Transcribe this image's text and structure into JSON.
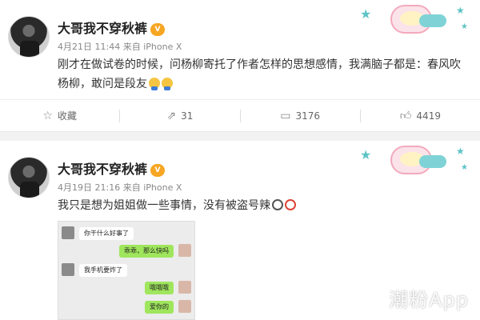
{
  "posts": [
    {
      "username": "大哥我不穿秋裤",
      "vip_badge": "V",
      "date": "4月21日 11:44",
      "source_prefix": "来自",
      "source": "iPhone X",
      "content": "刚才在做试卷的时候，问杨柳寄托了作者怎样的思想感情，我满脑子都是：春风吹杨柳，敢问是段友",
      "actions": {
        "collect_label": "收藏",
        "repost_count": "31",
        "comment_count": "3176",
        "like_count": "4419"
      }
    },
    {
      "username": "大哥我不穿秋裤",
      "vip_badge": "V",
      "date": "4月19日 21:16",
      "source_prefix": "来自",
      "source": "iPhone X",
      "content": "我只是想为姐姐做一些事情，没有被盗号辣"
    }
  ],
  "chat": {
    "messages": [
      {
        "side": "left",
        "text": "你干什么好事了"
      },
      {
        "side": "right",
        "text": "乖乖，那么快吗"
      },
      {
        "side": "left",
        "text": "我手机要炸了"
      },
      {
        "side": "right",
        "text": "哦哦哦"
      },
      {
        "side": "right",
        "text": "爱你的"
      }
    ]
  },
  "watermark": "潮粉App",
  "icons": {
    "collect": "star-outline-icon",
    "repost": "repost-icon",
    "comment": "comment-icon",
    "like": "thumbs-up-icon"
  },
  "colors": {
    "vip": "#f6a623",
    "separator": "#f2f2f2",
    "chat_bubble_right": "#9fe65c",
    "deco_teal": "#5ec3c6"
  }
}
